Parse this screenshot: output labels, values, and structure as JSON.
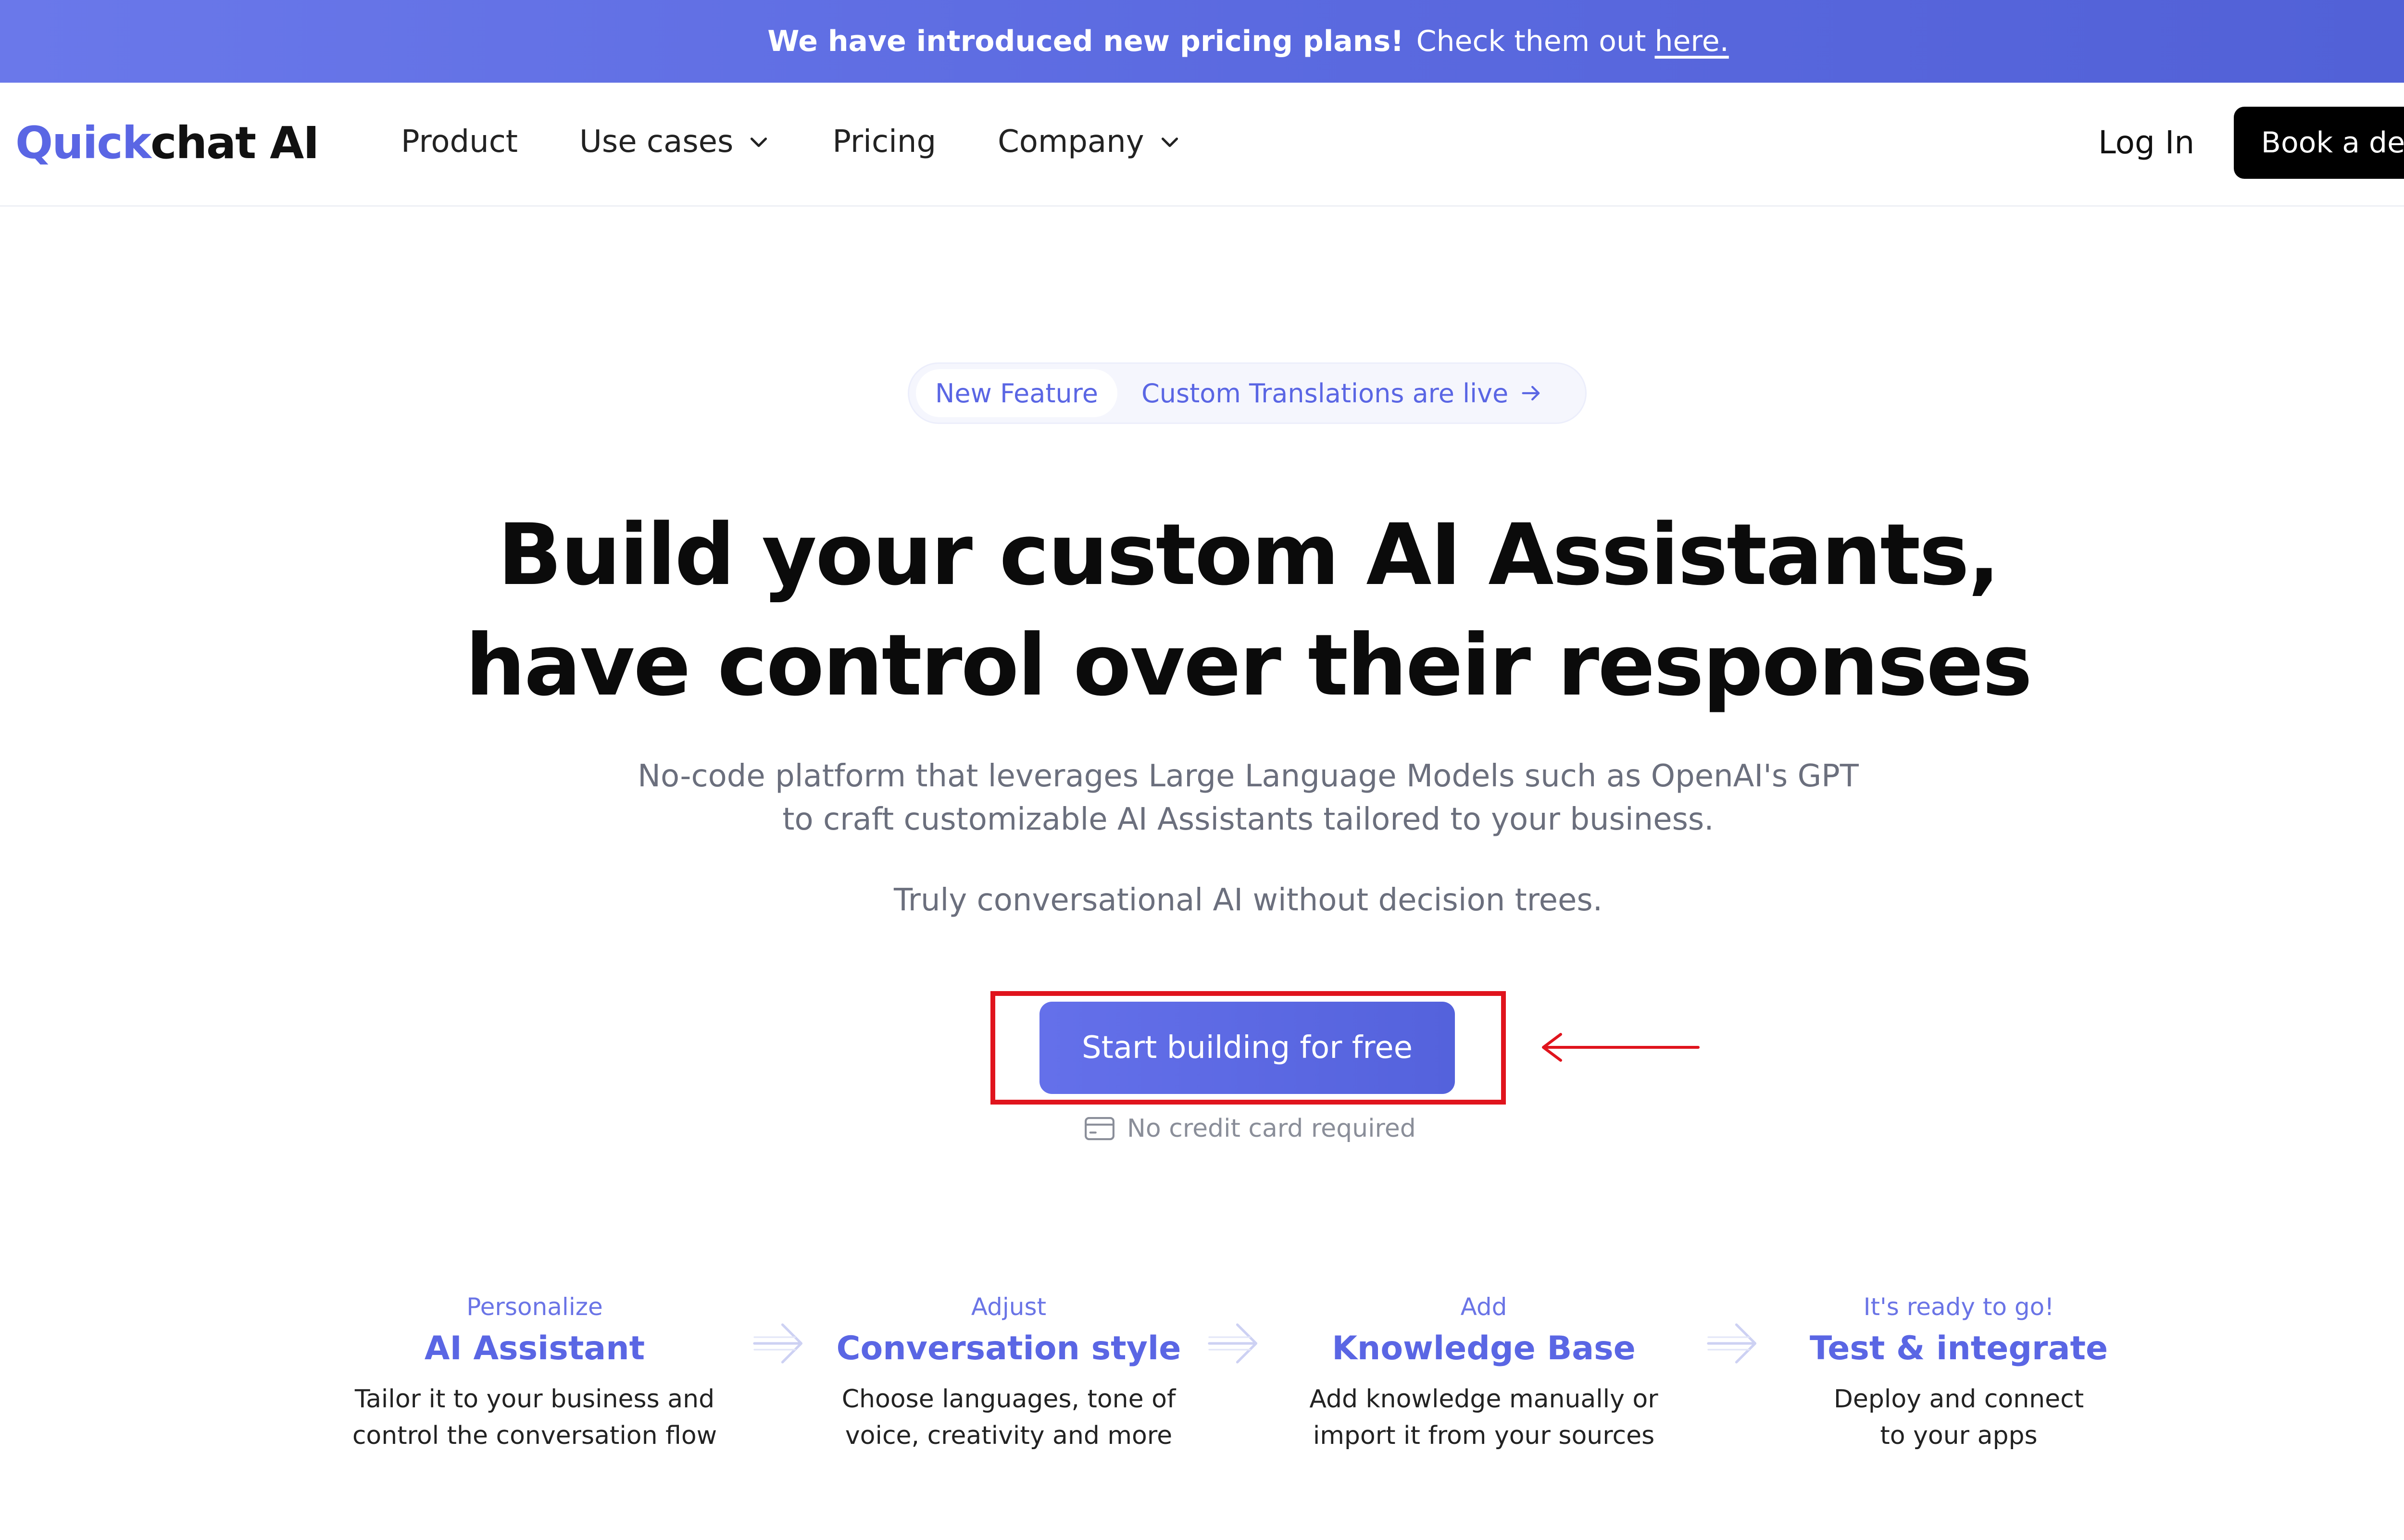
{
  "banner": {
    "strong": "We have introduced new pricing plans!",
    "text": "Check them out",
    "link": "here."
  },
  "nav": {
    "logo_part1": "Quick",
    "logo_part2": "chat AI",
    "links": [
      "Product",
      "Use cases",
      "Pricing",
      "Company"
    ],
    "login": "Log In",
    "demo": "Book a demo"
  },
  "pill": {
    "tag": "New Feature",
    "text": "Custom Translations are live"
  },
  "hero": {
    "title_line1": "Build your custom AI Assistants,",
    "title_line2": "have control over their responses",
    "sub_line1": "No-code platform that leverages Large Language Models such as OpenAI's GPT",
    "sub_line2": "to craft customizable AI Assistants tailored to your business.",
    "sub2": "Truly conversational AI without decision trees."
  },
  "cta": {
    "label": "Start building for free",
    "note": "No credit card required",
    "highlight_color": "#e0141d"
  },
  "steps": [
    {
      "kicker": "Personalize",
      "title": "AI Assistant",
      "desc1": "Tailor it to your business and",
      "desc2": "control the conversation flow"
    },
    {
      "kicker": "Adjust",
      "title": "Conversation style",
      "desc1": "Choose languages, tone of",
      "desc2": "voice, creativity and more"
    },
    {
      "kicker": "Add",
      "title": "Knowledge Base",
      "desc1": "Add knowledge manually or",
      "desc2": "import it from your sources"
    },
    {
      "kicker": "It's ready to go!",
      "title": "Test & integrate",
      "desc1": "Deploy and connect",
      "desc2": "to your apps"
    }
  ],
  "colors": {
    "accent": "#5a66e4",
    "banner": "#5b6ae0",
    "text_muted": "#6b6f7d"
  }
}
